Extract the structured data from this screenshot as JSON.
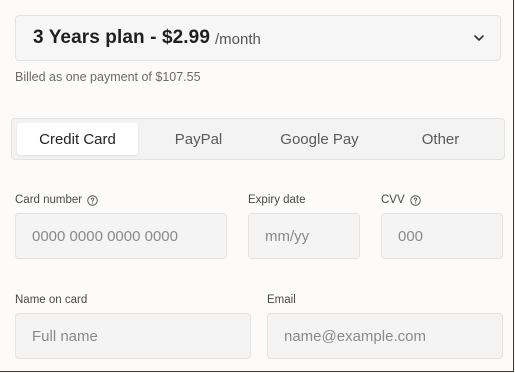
{
  "plan": {
    "title": "3 Years plan - $2.99",
    "unit": "/month",
    "billed": "Billed as one payment of $107.55"
  },
  "tabs": [
    {
      "label": "Credit Card",
      "active": true
    },
    {
      "label": "PayPal",
      "active": false
    },
    {
      "label": "Google Pay",
      "active": false
    },
    {
      "label": "Other",
      "active": false
    }
  ],
  "form": {
    "card_number": {
      "label": "Card number",
      "placeholder": "0000 0000 0000 0000"
    },
    "expiry": {
      "label": "Expiry date",
      "placeholder": "mm/yy"
    },
    "cvv": {
      "label": "CVV",
      "placeholder": "000"
    },
    "name": {
      "label": "Name on card",
      "placeholder": "Full name"
    },
    "email": {
      "label": "Email",
      "placeholder": "name@example.com"
    }
  },
  "icons": {
    "dropdown": "chevron-down-icon",
    "help": "question-circle-icon"
  }
}
